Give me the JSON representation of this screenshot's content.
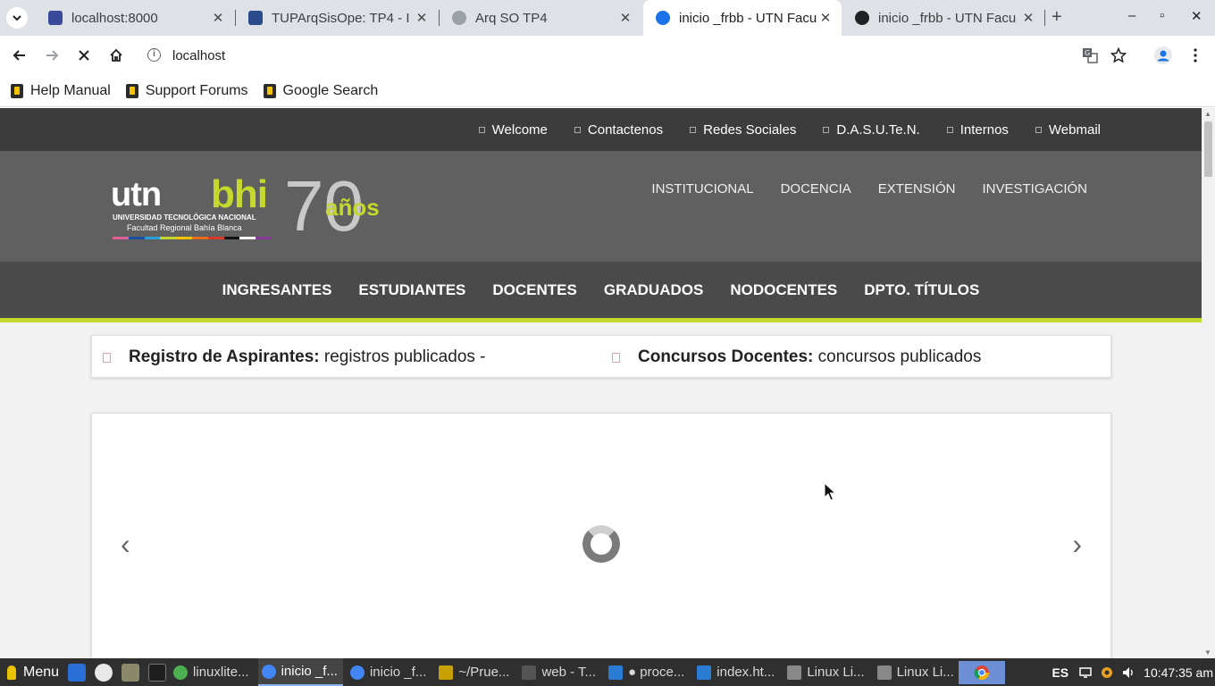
{
  "browser": {
    "tabs": [
      {
        "title": "localhost:8000",
        "favicon_color": "#3a4a9a"
      },
      {
        "title": "TUPArqSisOpe: TP4 - I",
        "favicon_color": "#2b4a8c"
      },
      {
        "title": "Arq SO TP4",
        "favicon_color": "#9aa0a6"
      },
      {
        "title": "inicio _frbb - UTN Facu",
        "favicon_color": "#1a73e8"
      },
      {
        "title": "inicio _frbb - UTN Facu",
        "favicon_color": "#202124"
      }
    ],
    "active_tab_index": 3,
    "address": "localhost",
    "bookmarks": [
      "Help Manual",
      "Support Forums",
      "Google Search"
    ]
  },
  "site": {
    "top_links": [
      "Welcome",
      "Contactenos",
      "Redes Sociales",
      "D.A.S.U.Te.N.",
      "Internos",
      "Webmail"
    ],
    "logo": {
      "utn": "utn",
      "bhi": "bhi",
      "university": "UNIVERSIDAD TECNOLÓGICA NACIONAL",
      "faculty": "Facultad Regional Bahía Blanca",
      "seventy": "70",
      "anos": "años"
    },
    "main_nav": [
      "INSTITUCIONAL",
      "DOCENCIA",
      "EXTENSIÓN",
      "INVESTIGACIÓN"
    ],
    "section_nav": [
      "INGRESANTES",
      "ESTUDIANTES",
      "DOCENTES",
      "GRADUADOS",
      "NODOCENTES",
      "DPTO. TÍTULOS"
    ],
    "news": [
      {
        "bold": "Registro de Aspirantes:",
        "text": " registros publicados -"
      },
      {
        "bold": "Concursos Docentes:",
        "text": " concursos publicados"
      }
    ],
    "slider": {
      "prev": "‹",
      "next": "›"
    },
    "colors": {
      "accent": "#c4d82e",
      "topbar": "#3c3c3c",
      "header": "#606060",
      "secnav": "#4a4a4a"
    }
  },
  "taskbar": {
    "menu_label": "Menu",
    "tasks": [
      {
        "label": "linuxlite...",
        "color": "#4caf50"
      },
      {
        "label": "inicio _f...",
        "color": "#4285f4"
      },
      {
        "label": "inicio _f...",
        "color": "#4285f4"
      },
      {
        "label": "~/Prue...",
        "color": "#c8a000"
      },
      {
        "label": "web - T...",
        "color": "#555"
      },
      {
        "label": "● proce...",
        "color": "#2a7bd4"
      },
      {
        "label": "index.ht...",
        "color": "#2a7bd4"
      },
      {
        "label": "Linux Li...",
        "color": "#888"
      },
      {
        "label": "Linux Li...",
        "color": "#888"
      }
    ],
    "language": "ES",
    "clock": "10:47:35 am"
  }
}
